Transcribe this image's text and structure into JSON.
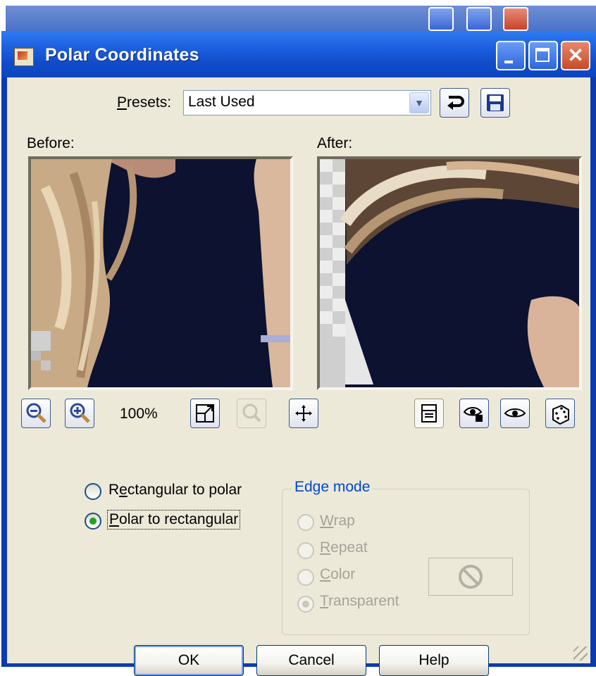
{
  "dialog": {
    "title": "Polar Coordinates"
  },
  "presets": {
    "label_prefix": "",
    "label_access": "P",
    "label_rest": "resets:",
    "value": "Last Used"
  },
  "previews": {
    "before_label": "Before:",
    "after_label": "After:",
    "zoom_text": "100%"
  },
  "mode": {
    "options": [
      {
        "prefix": "R",
        "access": "e",
        "rest": "ctangular to polar",
        "checked": false
      },
      {
        "prefix": "",
        "access": "P",
        "rest": "olar to rectangular",
        "checked": true
      }
    ]
  },
  "edge_mode": {
    "title": "Edge mode",
    "options": [
      {
        "prefix": "",
        "access": "W",
        "rest": "rap",
        "checked": false
      },
      {
        "prefix": "",
        "access": "R",
        "rest": "epeat",
        "checked": false
      },
      {
        "prefix": "",
        "access": "C",
        "rest": "olor",
        "checked": false
      },
      {
        "prefix": "",
        "access": "T",
        "rest": "ransparent",
        "checked": true
      }
    ]
  },
  "buttons": {
    "ok": "OK",
    "cancel": "Cancel",
    "help": "Help"
  },
  "icons": {
    "zoom_out": "zoom-out-icon",
    "zoom_in": "zoom-in-icon",
    "actual_size": "actual-size-icon",
    "zoom_disabled": "zoom-to-fit-icon",
    "move": "move-icon",
    "presets_reset": "reset-icon",
    "presets_save": "save-icon",
    "proof": "proof-icon",
    "auto_proof": "auto-proof-icon",
    "preview_on_image": "preview-icon",
    "randomize": "dice-icon",
    "no_color": "no-color-icon"
  },
  "colors": {
    "titlebar": "#0d45c0",
    "dialog_face": "#ece9d8",
    "group_label": "#0046d5",
    "radio_check": "#21a121"
  }
}
